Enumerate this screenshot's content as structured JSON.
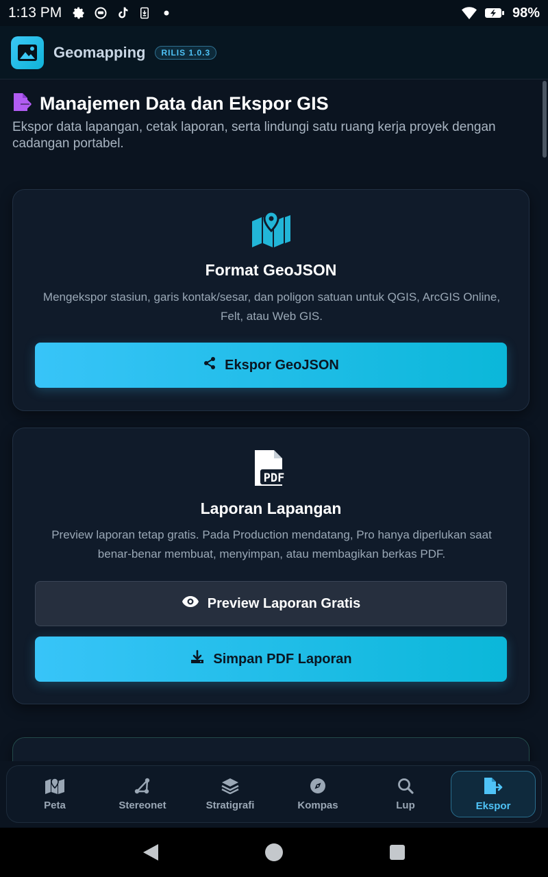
{
  "status_bar": {
    "time": "1:13 PM",
    "battery": "98%"
  },
  "app": {
    "title": "Geomapping",
    "badge": "RILIS 1.0.3"
  },
  "page": {
    "title": "Manajemen Data dan Ekspor GIS",
    "description": "Ekspor data lapangan, cetak laporan, serta lindungi satu ruang kerja proyek dengan cadangan portabel."
  },
  "cards": [
    {
      "icon": "map-pin-icon",
      "title": "Format GeoJSON",
      "description": "Mengekspor stasiun, garis kontak/sesar, dan poligon satuan untuk QGIS, ArcGIS Online, Felt, atau Web GIS.",
      "button_label": "Ekspor GeoJSON"
    },
    {
      "icon": "pdf-file-icon",
      "title": "Laporan Lapangan",
      "description": "Preview laporan tetap gratis. Pada Production mendatang, Pro hanya diperlukan saat benar-benar membuat, menyimpan, atau membagikan berkas PDF.",
      "preview_label": "Preview Laporan Gratis",
      "save_label": "Simpan PDF Laporan"
    }
  ],
  "nav": [
    {
      "label": "Peta",
      "icon": "map-icon"
    },
    {
      "label": "Stereonet",
      "icon": "stereonet-icon"
    },
    {
      "label": "Stratigrafi",
      "icon": "layers-icon"
    },
    {
      "label": "Kompas",
      "icon": "compass-icon"
    },
    {
      "label": "Lup",
      "icon": "magnifier-icon"
    },
    {
      "label": "Ekspor",
      "icon": "export-file-icon"
    }
  ],
  "colors": {
    "accent": "#38c4f8",
    "title_icon": "#b15cf2",
    "background": "#0b1420"
  }
}
